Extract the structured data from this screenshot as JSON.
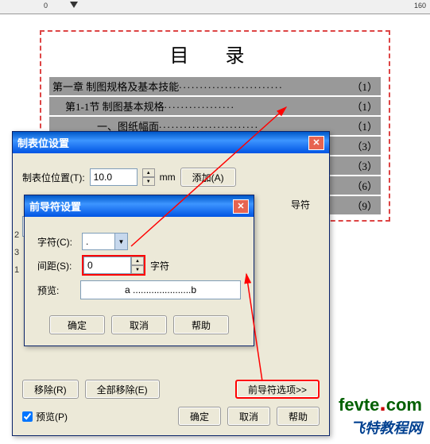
{
  "ruler": {
    "start": 0,
    "marks": [
      "0",
      "",
      "",
      "",
      "",
      "",
      "",
      "",
      "",
      "",
      "",
      "",
      "",
      "",
      "",
      "",
      "160"
    ]
  },
  "toc": {
    "title": "目 录",
    "lines": [
      {
        "text": "第一章 制图规格及基本技能",
        "page": "（1）"
      },
      {
        "text": "第1-1节 制图基本规格",
        "page": "（1）"
      },
      {
        "text": "一、图纸幅面",
        "page": "（1）"
      },
      {
        "text": "",
        "page": "（3）"
      },
      {
        "text": "",
        "page": "（3）"
      },
      {
        "text": "",
        "page": "（6）"
      },
      {
        "text": "",
        "page": "（9）"
      }
    ]
  },
  "dialog1": {
    "title": "制表位设置",
    "tab_pos_label": "制表位位置(T):",
    "tab_pos_value": "10.0",
    "unit": "mm",
    "add_btn": "添加(A)",
    "leader_label": "导符",
    "remove_btn": "移除(R)",
    "remove_all_btn": "全部移除(E)",
    "leader_opts_btn": "前导符选项>>",
    "preview_chk": "预览(P)",
    "ok": "确定",
    "cancel": "取消",
    "help": "帮助"
  },
  "dialog2": {
    "title": "前导符设置",
    "char_label": "字符(C):",
    "char_value": ".",
    "spacing_label": "间距(S):",
    "spacing_value": "0",
    "spacing_unit": "字符",
    "preview_label": "预览:",
    "preview_text": "a ......................b",
    "ok": "确定",
    "cancel": "取消",
    "help": "帮助"
  },
  "watermark": {
    "en_prefix": "fevte",
    "en_dot": ".",
    "en_suffix": "com",
    "cn": "飞特教程网"
  },
  "side_nums": [
    "2",
    "3",
    "1"
  ]
}
